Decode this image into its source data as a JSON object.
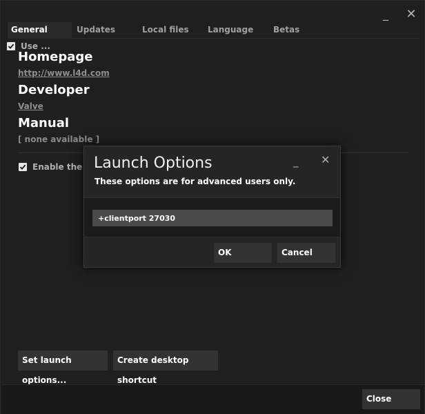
{
  "window": {
    "minimize_glyph": "_",
    "close_glyph": "✕"
  },
  "tabs": [
    {
      "label": "General",
      "active": true
    },
    {
      "label": "Updates",
      "active": false
    },
    {
      "label": "Local files",
      "active": false
    },
    {
      "label": "Language",
      "active": false
    },
    {
      "label": "Betas",
      "active": false
    }
  ],
  "general": {
    "use_checkbox_label": "Use ...",
    "homepage_heading": "Homepage",
    "homepage_link": "http://www.l4d.com",
    "developer_heading": "Developer",
    "developer_link": "Valve",
    "manual_heading": "Manual",
    "manual_value": "[ none available ]",
    "overlay_checkbox_label": "Enable the St",
    "set_launch_options_button": "Set launch options...",
    "create_shortcut_button": "Create desktop shortcut"
  },
  "footer": {
    "close_button": "Close"
  },
  "dialog": {
    "title": "Launch Options",
    "subtitle": "These options are for advanced users only.",
    "input_value": "+clientport 27030",
    "ok_button": "OK",
    "cancel_button": "Cancel",
    "minimize_glyph": "_",
    "close_glyph": "✕"
  },
  "colors": {
    "background": "#1f1f1f",
    "active_tab": "#2b2b2b",
    "button": "#333333",
    "input": "#4a4a4a"
  }
}
